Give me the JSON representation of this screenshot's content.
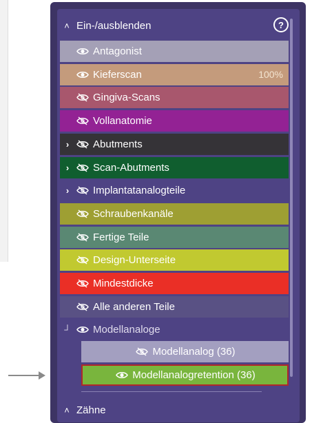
{
  "section": {
    "title": "Ein-/ausblenden",
    "help": "?"
  },
  "rows": [
    {
      "label": "Antagonist",
      "bg": "#a4a0b6",
      "visible": true,
      "expandable": false
    },
    {
      "label": "Kieferscan",
      "bg": "#c49b7c",
      "visible": true,
      "expandable": false,
      "percent": "100%"
    },
    {
      "label": "Gingiva-Scans",
      "bg": "#a8576d",
      "visible": false,
      "expandable": false
    },
    {
      "label": "Vollanatomie",
      "bg": "#932294",
      "visible": false,
      "expandable": false
    },
    {
      "label": "Abutments",
      "bg": "#353337",
      "visible": false,
      "expandable": true
    },
    {
      "label": "Scan-Abutments",
      "bg": "#105e2f",
      "visible": false,
      "expandable": true
    },
    {
      "label": "Implantatanalogteile",
      "bg": "#4e4384",
      "visible": false,
      "expandable": true
    },
    {
      "label": "Schraubenkanäle",
      "bg": "#9e9f33",
      "visible": false,
      "expandable": false
    },
    {
      "label": "Fertige Teile",
      "bg": "#5a8873",
      "visible": false,
      "expandable": false
    },
    {
      "label": "Design-Unterseite",
      "bg": "#c1c930",
      "visible": false,
      "expandable": false
    },
    {
      "label": "Mindestdicke",
      "bg": "#ea2f26",
      "visible": false,
      "expandable": false
    },
    {
      "label": "Alle anderen Teile",
      "bg": "#595184",
      "visible": false,
      "expandable": false
    },
    {
      "label": "Modellanaloge",
      "bg": "#4e4384",
      "visible": true,
      "expandable": "collapsed-child",
      "dim": true
    }
  ],
  "sub_rows": [
    {
      "label": "Modellanalog (36)",
      "bg": "#a39fc0",
      "visible": false
    },
    {
      "label": "Modellanalogretention (36)",
      "bg": "#79b53d",
      "visible": true,
      "selected": true,
      "border": "#b0282a"
    }
  ],
  "footer_section": {
    "title": "Zähne"
  },
  "icons": {
    "visible": "eye-icon",
    "hidden": "eye-slash-icon",
    "expand": "chevron-right-icon",
    "collapse": "chevron-up-icon"
  }
}
